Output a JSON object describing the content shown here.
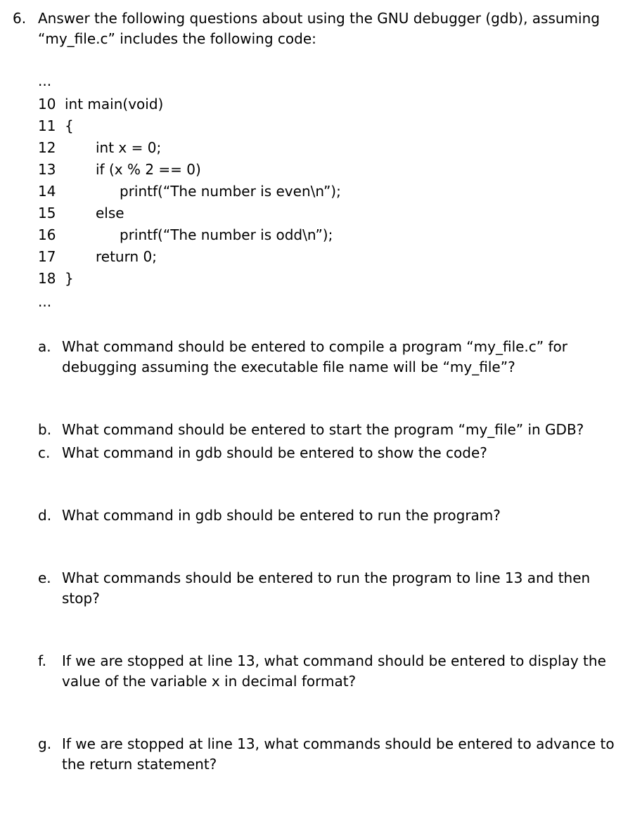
{
  "question": {
    "number": "6.",
    "prompt": "Answer the following questions about using the GNU debugger (gdb), assuming “my_file.c” includes the following code:"
  },
  "code": {
    "pre_ellipsis": "...",
    "lines": [
      {
        "n": "10",
        "indent": 0,
        "text": "int main(void)"
      },
      {
        "n": "11",
        "indent": 0,
        "text": "{"
      },
      {
        "n": "12",
        "indent": 1,
        "text": "int x = 0;"
      },
      {
        "n": "13",
        "indent": 1,
        "text": "if (x % 2 == 0)"
      },
      {
        "n": "14",
        "indent": 2,
        "text": "printf(“The number is even\\n”);"
      },
      {
        "n": "15",
        "indent": 1,
        "text": "else"
      },
      {
        "n": "16",
        "indent": 2,
        "text": "printf(“The number is odd\\n”);"
      },
      {
        "n": "17",
        "indent": 1,
        "text": "return 0;"
      },
      {
        "n": "18",
        "indent": 0,
        "text": "}"
      }
    ],
    "post_ellipsis": "..."
  },
  "subquestions": [
    {
      "marker": "a.",
      "tight": false,
      "text": "What command should be entered to compile a program “my_file.c” for debugging assuming the executable file name will be “my_file”?"
    },
    {
      "marker": "b.",
      "tight": true,
      "text": "What command should be entered to start the program “my_file” in GDB?"
    },
    {
      "marker": "c.",
      "tight": false,
      "text": "What command in gdb should be entered to show the code?"
    },
    {
      "marker": "d.",
      "tight": false,
      "text": "What command in gdb should be entered to run the program?"
    },
    {
      "marker": "e.",
      "tight": false,
      "text": "What commands should be entered to run the program to line 13 and then stop?"
    },
    {
      "marker": "f.",
      "tight": false,
      "text": "If we are stopped at line 13, what command should be entered to display the value of the variable x in decimal format?"
    },
    {
      "marker": "g.",
      "tight": false,
      "text": "If we are stopped at line 13, what commands should be entered to advance to the return statement?"
    }
  ]
}
